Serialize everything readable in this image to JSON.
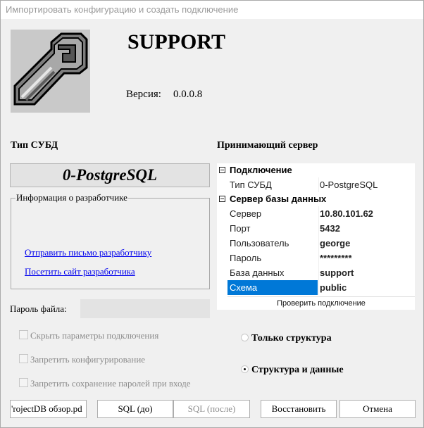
{
  "window": {
    "title": "Импортировать конфигурацию и создать подключение"
  },
  "app": {
    "name": "SUPPORT",
    "version_label": "Версия:",
    "version": "0.0.0.8"
  },
  "db_type": {
    "heading": "Тип СУБД",
    "value": "0-PostgreSQL"
  },
  "developer": {
    "group_label": "Информация о разработчике",
    "mail_link": "Отправить письмо разработчику",
    "site_link": "Посетить сайт разработчика"
  },
  "file_password": {
    "label": "Пароль файла:",
    "value": ""
  },
  "checkboxes": [
    {
      "label": "Скрыть параметры подключения",
      "checked": false,
      "enabled": false
    },
    {
      "label": "Запретить конфигурирование",
      "checked": false,
      "enabled": false
    },
    {
      "label": "Запретить сохранение паролей при входе",
      "checked": false,
      "enabled": false
    }
  ],
  "server": {
    "heading": "Принимающий сервер",
    "connection": {
      "title": "Подключение",
      "rows": [
        {
          "name": "Тип СУБД",
          "value": "0-PostgreSQL"
        }
      ]
    },
    "db_server": {
      "title": "Сервер базы данных",
      "rows": [
        {
          "name": "Сервер",
          "value": "10.80.101.62"
        },
        {
          "name": "Порт",
          "value": "5432"
        },
        {
          "name": "Пользователь",
          "value": "george"
        },
        {
          "name": "Пароль",
          "value": "*********"
        },
        {
          "name": "База данных",
          "value": "support"
        },
        {
          "name": "Схема",
          "value": "public"
        }
      ]
    },
    "test_button": "Проверить подключение"
  },
  "import_mode": {
    "options": [
      {
        "label": "Только структура",
        "selected": false
      },
      {
        "label": "Структура и данные",
        "selected": true
      }
    ]
  },
  "buttons": {
    "file": "'rojectDB обзор.pd",
    "sql_before": "SQL (до)",
    "sql_after": "SQL (после)",
    "restore": "Восстановить",
    "cancel": "Отмена"
  },
  "colors": {
    "selection": "#0078d7",
    "link": "#0000ee",
    "disabled_text": "#8c8c8c",
    "window_bg": "#f0f0f0"
  }
}
